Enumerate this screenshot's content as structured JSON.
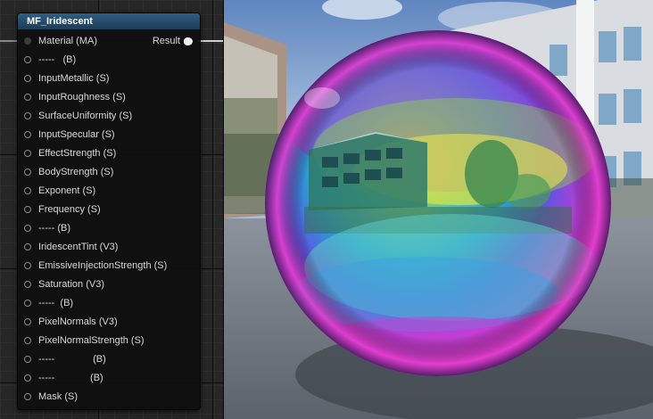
{
  "node": {
    "title": "MF_Iridescent",
    "output_label": "Result",
    "inputs": [
      {
        "label": "Material (MA)",
        "filled": true
      },
      {
        "label": "-----   (B)",
        "filled": false
      },
      {
        "label": "InputMetallic (S)",
        "filled": false
      },
      {
        "label": "InputRoughness (S)",
        "filled": false
      },
      {
        "label": "SurfaceUniformity (S)",
        "filled": false
      },
      {
        "label": "InputSpecular (S)",
        "filled": false
      },
      {
        "label": "EffectStrength (S)",
        "filled": false
      },
      {
        "label": "BodyStrength (S)",
        "filled": false
      },
      {
        "label": "Exponent (S)",
        "filled": false
      },
      {
        "label": "Frequency (S)",
        "filled": false
      },
      {
        "label": "----- (B)",
        "filled": false
      },
      {
        "label": "IridescentTint (V3)",
        "filled": false
      },
      {
        "label": "EmissiveInjectionStrength (S)",
        "filled": false
      },
      {
        "label": "Saturation (V3)",
        "filled": false
      },
      {
        "label": "-----  (B)",
        "filled": false
      },
      {
        "label": "PixelNormals (V3)",
        "filled": false
      },
      {
        "label": "PixelNormalStrength (S)",
        "filled": false
      },
      {
        "label": "-----              (B)",
        "filled": false
      },
      {
        "label": "-----             (B)",
        "filled": false
      },
      {
        "label": "Mask (S)",
        "filled": false
      }
    ]
  },
  "colors": {
    "header": "#2e5d82",
    "panel_bg": "#262626"
  },
  "icons": {
    "input_pin": "circle-outline-icon",
    "output_pin": "filled-pin-icon"
  }
}
